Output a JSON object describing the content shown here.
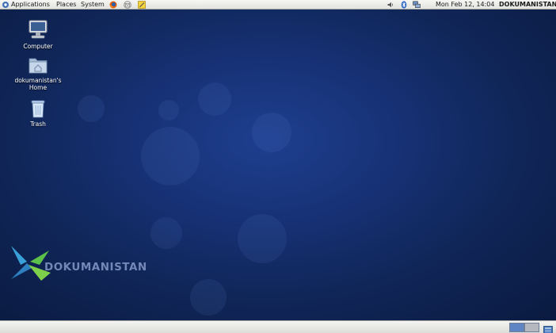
{
  "top_panel": {
    "menus": {
      "applications": "Applications",
      "places": "Places",
      "system": "System"
    },
    "launchers": [
      "firefox-icon",
      "mail-client-icon",
      "text-editor-icon"
    ],
    "tray": [
      "volume-icon",
      "bluetooth-icon",
      "network-icon"
    ],
    "clock": "Mon Feb 12, 14:04",
    "username": "DOKUMANISTAN"
  },
  "desktop": {
    "icons": [
      {
        "label": "Computer",
        "icon": "computer-icon"
      },
      {
        "label": "dokumanistan's Home",
        "icon": "home-folder-icon"
      },
      {
        "label": "Trash",
        "icon": "trash-icon"
      }
    ],
    "watermark": "DOKUMANISTAN"
  },
  "bottom_panel": {
    "workspaces": [
      "workspace-1",
      "workspace-2"
    ],
    "active_workspace": 1
  },
  "colors": {
    "desktop_bg": "#173277",
    "panel_bg": "#e8e8e5",
    "workspace_active": "#5f85c4"
  }
}
